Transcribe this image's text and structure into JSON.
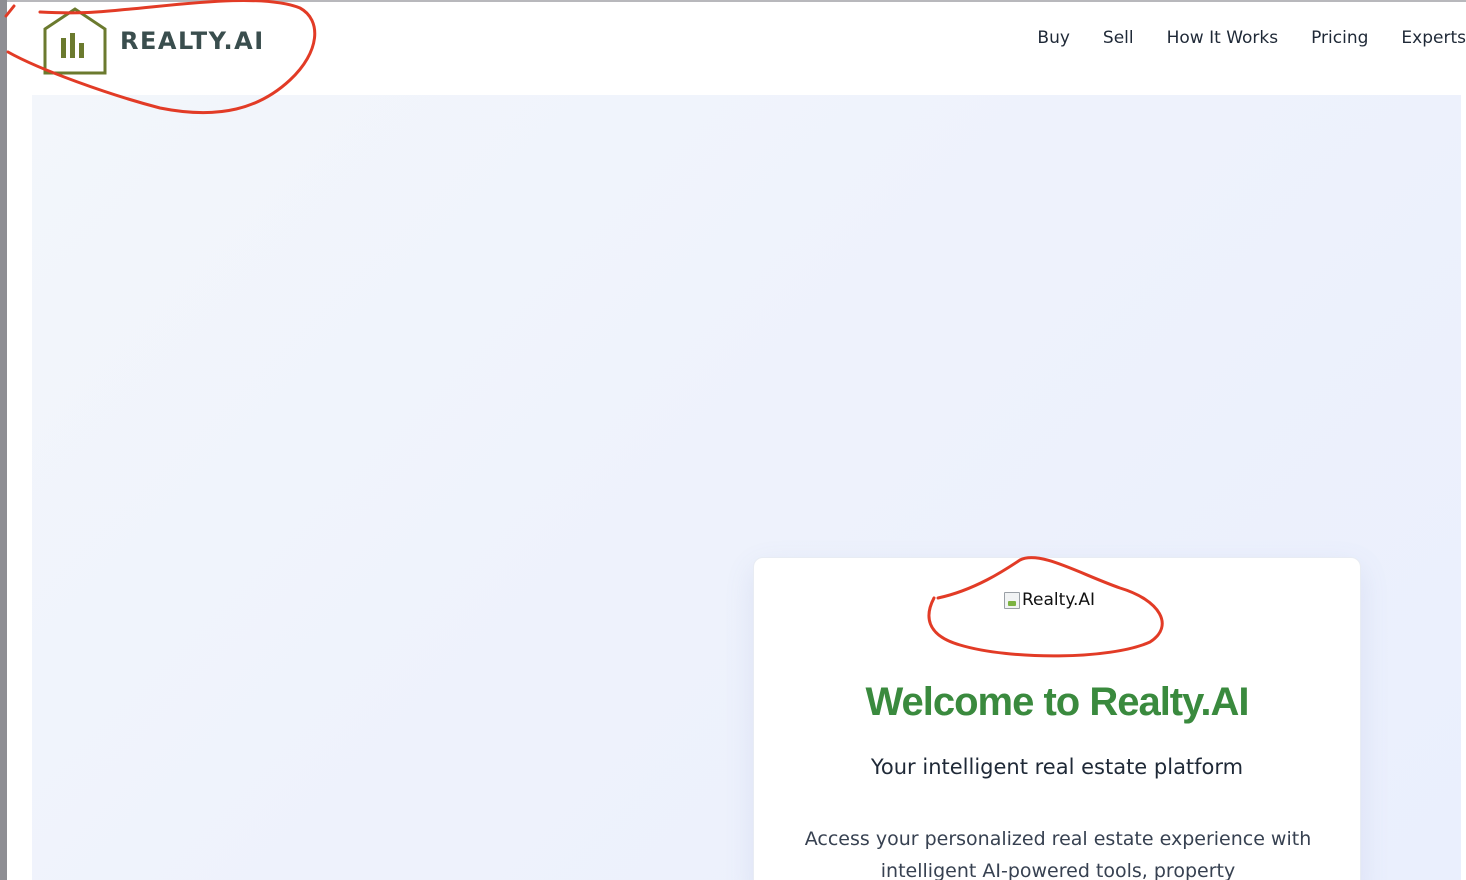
{
  "header": {
    "logo_text": "REALTY.AI",
    "logo_icon": "house-chart-icon",
    "nav": [
      {
        "label": "Buy"
      },
      {
        "label": "Sell"
      },
      {
        "label": "How It Works"
      },
      {
        "label": "Pricing"
      },
      {
        "label": "Experts"
      }
    ]
  },
  "card": {
    "image_alt": "Realty.AI",
    "image_icon": "broken-image-icon",
    "title": "Welcome to Realty.AI",
    "subtitle": "Your intelligent real estate platform",
    "description": "Access your personalized real estate experience with intelligent AI-powered tools, property"
  },
  "colors": {
    "brand_green": "#3a8a3e",
    "logo_olive": "#6b7a2e",
    "logo_text": "#3a4e4e",
    "annotation_red": "#e23b26",
    "hero_bg": "#eef2fc"
  }
}
